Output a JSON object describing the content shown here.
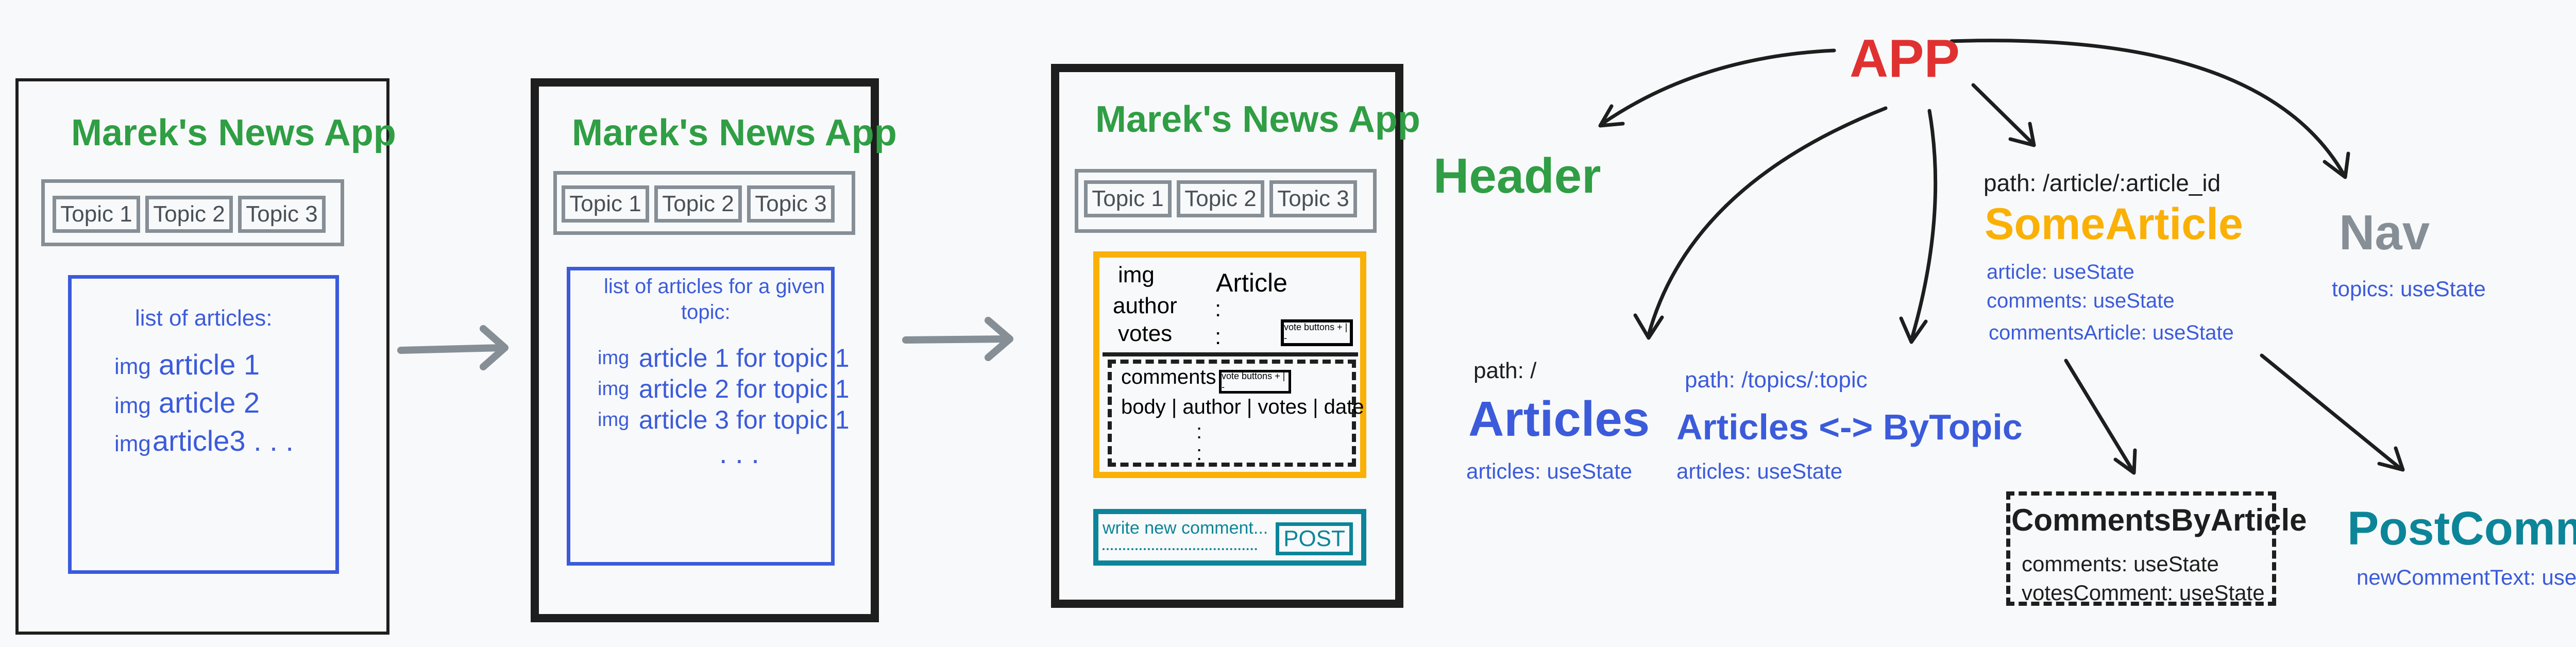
{
  "wireframes": {
    "app_title": "Marek's News App",
    "tabs": [
      "Topic 1",
      "Topic 2",
      "Topic 3"
    ],
    "screen1": {
      "list_title": "list of articles:",
      "items": [
        {
          "img": "img",
          "text": "article 1"
        },
        {
          "img": "img",
          "text": "article 2"
        },
        {
          "img": "img",
          "text": "article3 . . ."
        }
      ]
    },
    "screen2": {
      "list_title_line1": "list of articles for a given",
      "list_title_line2": "topic:",
      "items": [
        {
          "img": "img",
          "text": "article 1 for topic 1"
        },
        {
          "img": "img",
          "text": "article 2 for topic 1"
        },
        {
          "img": "img",
          "text": "article 3 for topic 1"
        }
      ],
      "ellipsis": ". . ."
    },
    "screen3": {
      "img": "img",
      "author": "author",
      "votes": "votes",
      "article": "Article",
      "colon": ":",
      "vote_buttons": "vote buttons + | -",
      "comments": "comments",
      "comment_fields": "body | author | votes | date",
      "comment_dots": ":",
      "write_comment": "write new comment...",
      "post": "POST"
    }
  },
  "tree": {
    "app": "APP",
    "header": "Header",
    "articles": {
      "path": "path: /",
      "name": "Articles",
      "state": "articles: useState"
    },
    "by_topic": {
      "path": "path: /topics/:topic",
      "name": "Articles <-> ByTopic",
      "state": "articles: useState"
    },
    "some_article": {
      "path": "path: /article/:article_id",
      "name": "SomeArticle",
      "states": [
        "article: useState",
        "comments: useState",
        "commentsArticle: useState"
      ]
    },
    "nav": {
      "name": "Nav",
      "state": "topics: useState"
    },
    "comments_by_article": {
      "name": "CommentsByArticle",
      "states": [
        "comments: useState",
        "votesComment: useState"
      ]
    },
    "post_comment": {
      "name": "PostComment",
      "state": "newCommentText: useState"
    }
  },
  "colors": {
    "green": "#2f9e44",
    "blue": "#3b5bdb",
    "gray": "#868e96",
    "teal": "#0c8599",
    "red": "#e03131",
    "yellow": "#fab005",
    "dark": "#1e1e1e"
  }
}
